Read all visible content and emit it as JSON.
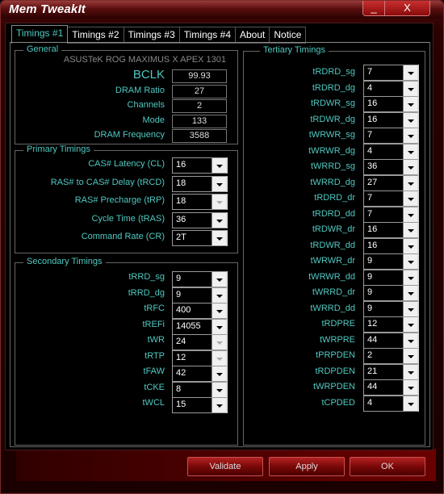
{
  "window": {
    "title": "Mem TweakIt",
    "minimize_glyph": "_",
    "close_glyph": "X"
  },
  "tabs": [
    {
      "label": "Timings #1",
      "active": true
    },
    {
      "label": "Timings #2"
    },
    {
      "label": "Timings #3"
    },
    {
      "label": "Timings #4"
    },
    {
      "label": "About"
    },
    {
      "label": "Notice"
    }
  ],
  "general": {
    "title": "General",
    "board": "ASUSTeK ROG MAXIMUS X APEX 1301",
    "fields": [
      {
        "label": "BCLK",
        "value": "99.93"
      },
      {
        "label": "DRAM Ratio",
        "value": "27"
      },
      {
        "label": "Channels",
        "value": "2"
      },
      {
        "label": "Mode",
        "value": "133"
      },
      {
        "label": "DRAM Frequency",
        "value": "3588"
      }
    ]
  },
  "primary": {
    "title": "Primary Timings",
    "fields": [
      {
        "label": "CAS# Latency (CL)",
        "value": "16",
        "enabled": true
      },
      {
        "label": "RAS# to CAS# Delay (tRCD)",
        "value": "18",
        "enabled": true
      },
      {
        "label": "RAS# Precharge (tRP)",
        "value": "18",
        "enabled": false
      },
      {
        "label": "Cycle Time (tRAS)",
        "value": "36",
        "enabled": true
      },
      {
        "label": "Command Rate (CR)",
        "value": "2T",
        "enabled": true
      }
    ]
  },
  "secondary": {
    "title": "Secondary Timings",
    "fields": [
      {
        "label": "tRRD_sg",
        "value": "9",
        "enabled": true
      },
      {
        "label": "tRRD_dg",
        "value": "9",
        "enabled": true
      },
      {
        "label": "tRFC",
        "value": "400",
        "enabled": true
      },
      {
        "label": "tREFi",
        "value": "14055",
        "enabled": true
      },
      {
        "label": "tWR",
        "value": "24",
        "enabled": false
      },
      {
        "label": "tRTP",
        "value": "12",
        "enabled": false
      },
      {
        "label": "tFAW",
        "value": "42",
        "enabled": true
      },
      {
        "label": "tCKE",
        "value": "8",
        "enabled": true
      },
      {
        "label": "tWCL",
        "value": "15",
        "enabled": true
      }
    ]
  },
  "tertiary": {
    "title": "Tertiary Timings",
    "fields": [
      {
        "label": "tRDRD_sg",
        "value": "7"
      },
      {
        "label": "tRDRD_dg",
        "value": "4"
      },
      {
        "label": "tRDWR_sg",
        "value": "16"
      },
      {
        "label": "tRDWR_dg",
        "value": "16"
      },
      {
        "label": "tWRWR_sg",
        "value": "7"
      },
      {
        "label": "tWRWR_dg",
        "value": "4"
      },
      {
        "label": "tWRRD_sg",
        "value": "36"
      },
      {
        "label": "tWRRD_dg",
        "value": "27"
      },
      {
        "label": "tRDRD_dr",
        "value": "7"
      },
      {
        "label": "tRDRD_dd",
        "value": "7"
      },
      {
        "label": "tRDWR_dr",
        "value": "16"
      },
      {
        "label": "tRDWR_dd",
        "value": "16"
      },
      {
        "label": "tWRWR_dr",
        "value": "9"
      },
      {
        "label": "tWRWR_dd",
        "value": "9"
      },
      {
        "label": "tWRRD_dr",
        "value": "9"
      },
      {
        "label": "tWRRD_dd",
        "value": "9"
      },
      {
        "label": "tRDPRE",
        "value": "12"
      },
      {
        "label": "tWRPRE",
        "value": "44"
      },
      {
        "label": "tPRPDEN",
        "value": "2"
      },
      {
        "label": "tRDPDEN",
        "value": "21"
      },
      {
        "label": "tWRPDEN",
        "value": "44"
      },
      {
        "label": "tCPDED",
        "value": "4"
      }
    ]
  },
  "buttons": {
    "validate": "Validate",
    "apply": "Apply",
    "ok": "OK"
  }
}
